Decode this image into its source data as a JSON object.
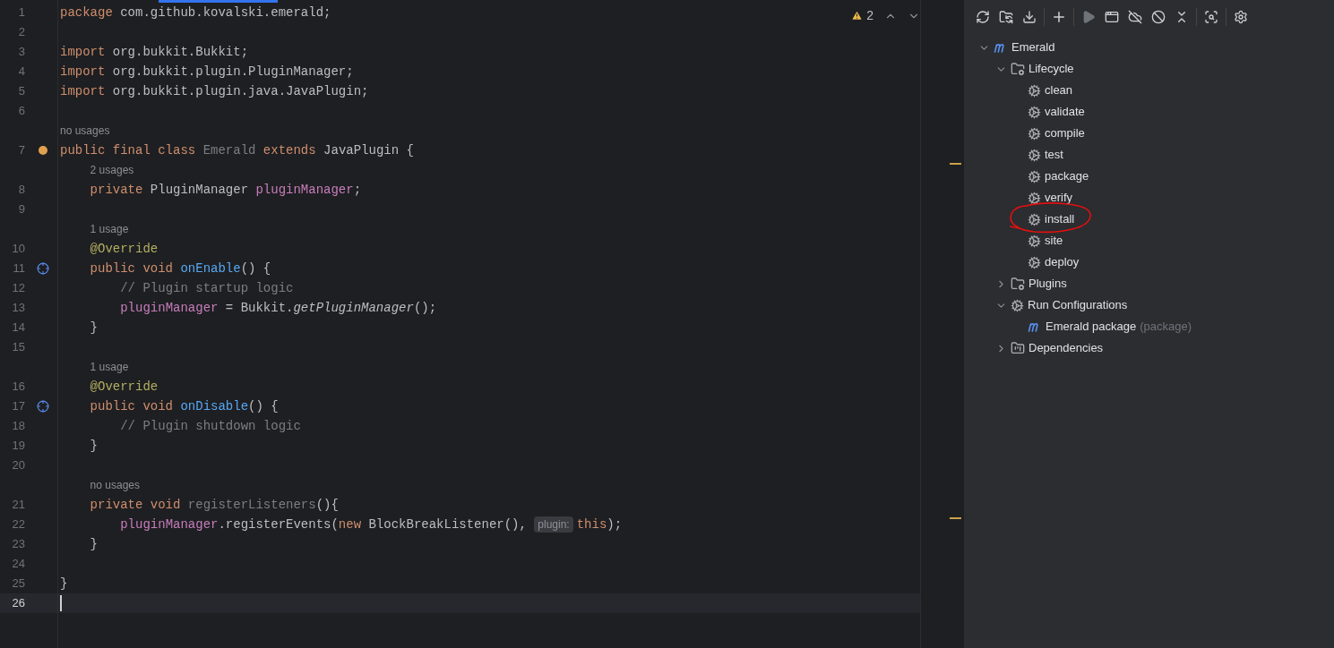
{
  "editor": {
    "warnings": {
      "count": "2"
    },
    "lines": [
      {
        "number": "1",
        "kind": "plain",
        "current": false,
        "tokens": [
          {
            "kind": "kw",
            "text": "package "
          },
          {
            "kind": "plain",
            "text": "com.github.kovalski.emerald;"
          }
        ]
      },
      {
        "number": "2",
        "kind": "plain",
        "current": false
      },
      {
        "number": "3",
        "kind": "plain",
        "current": false,
        "tokens": [
          {
            "kind": "kw",
            "text": "import "
          },
          {
            "kind": "plain",
            "text": "org.bukkit.Bukkit;"
          }
        ]
      },
      {
        "number": "4",
        "kind": "plain",
        "current": false,
        "tokens": [
          {
            "kind": "kw",
            "text": "import "
          },
          {
            "kind": "plain",
            "text": "org.bukkit.plugin.PluginManager;"
          }
        ]
      },
      {
        "number": "5",
        "kind": "plain",
        "current": false,
        "tokens": [
          {
            "kind": "kw",
            "text": "import "
          },
          {
            "kind": "plain",
            "text": "org.bukkit.plugin.java.JavaPlugin;"
          }
        ]
      },
      {
        "number": "6",
        "kind": "plain",
        "current": false
      },
      {
        "number": "7",
        "kind": "plugin",
        "current": false,
        "usages": "no usages",
        "tokens": [
          {
            "kind": "kw",
            "text": "public final class "
          },
          {
            "kind": "unused",
            "text": "Emerald "
          },
          {
            "kind": "kw",
            "text": "extends "
          },
          {
            "kind": "plain",
            "text": "JavaPlugin {"
          }
        ]
      },
      {
        "number": "8",
        "kind": "plain",
        "current": false,
        "usages": "2 usages",
        "tokens": [
          {
            "kind": "kw",
            "text": "    private "
          },
          {
            "kind": "plain",
            "text": "PluginManager "
          },
          {
            "kind": "field",
            "text": "pluginManager"
          },
          {
            "kind": "plain",
            "text": ";"
          }
        ]
      },
      {
        "number": "9",
        "kind": "plain",
        "current": false
      },
      {
        "number": "10",
        "kind": "plain",
        "current": false,
        "usages": "1 usage",
        "tokens": [
          {
            "kind": "annotation",
            "text": "    @Override"
          }
        ]
      },
      {
        "number": "11",
        "kind": "override",
        "current": false,
        "tokens": [
          {
            "kind": "kw",
            "text": "    public void "
          },
          {
            "kind": "method",
            "text": "onEnable"
          },
          {
            "kind": "plain",
            "text": "() {"
          }
        ]
      },
      {
        "number": "12",
        "kind": "plain",
        "current": false,
        "tokens": [
          {
            "kind": "comment",
            "text": "        // Plugin startup logic"
          }
        ]
      },
      {
        "number": "13",
        "kind": "plain",
        "current": false,
        "tokens": [
          {
            "kind": "field",
            "text": "        pluginManager"
          },
          {
            "kind": "plain",
            "text": " = Bukkit."
          },
          {
            "kind": "static",
            "text": "getPluginManager"
          },
          {
            "kind": "plain",
            "text": "();"
          }
        ]
      },
      {
        "number": "14",
        "kind": "plain",
        "current": false,
        "tokens": [
          {
            "kind": "plain",
            "text": "    }"
          }
        ]
      },
      {
        "number": "15",
        "kind": "plain",
        "current": false
      },
      {
        "number": "16",
        "kind": "plain",
        "current": false,
        "usages": "1 usage",
        "tokens": [
          {
            "kind": "annotation",
            "text": "    @Override"
          }
        ]
      },
      {
        "number": "17",
        "kind": "override",
        "current": false,
        "tokens": [
          {
            "kind": "kw",
            "text": "    public void "
          },
          {
            "kind": "method",
            "text": "onDisable"
          },
          {
            "kind": "plain",
            "text": "() {"
          }
        ]
      },
      {
        "number": "18",
        "kind": "plain",
        "current": false,
        "tokens": [
          {
            "kind": "comment",
            "text": "        // Plugin shutdown logic"
          }
        ]
      },
      {
        "number": "19",
        "kind": "plain",
        "current": false,
        "tokens": [
          {
            "kind": "plain",
            "text": "    }"
          }
        ]
      },
      {
        "number": "20",
        "kind": "plain",
        "current": false
      },
      {
        "number": "21",
        "kind": "plain",
        "current": false,
        "usages": "no usages",
        "tokens": [
          {
            "kind": "kw",
            "text": "    private void "
          },
          {
            "kind": "unused",
            "text": "registerListeners"
          },
          {
            "kind": "plain",
            "text": "(){"
          }
        ]
      },
      {
        "number": "22",
        "kind": "plain",
        "current": false,
        "tokens": [
          {
            "kind": "field",
            "text": "        pluginManager"
          },
          {
            "kind": "plain",
            "text": ".registerEvents("
          },
          {
            "kind": "kw",
            "text": "new "
          },
          {
            "kind": "plain",
            "text": "BlockBreakListener(), "
          },
          {
            "kind": "hint",
            "text": "plugin:"
          },
          {
            "kind": "kw",
            "text": "this"
          },
          {
            "kind": "plain",
            "text": ");"
          }
        ]
      },
      {
        "number": "23",
        "kind": "plain",
        "current": false,
        "tokens": [
          {
            "kind": "plain",
            "text": "    }"
          }
        ]
      },
      {
        "number": "24",
        "kind": "plain",
        "current": false
      },
      {
        "number": "25",
        "kind": "plain",
        "current": false,
        "tokens": [
          {
            "kind": "plain",
            "text": "}"
          }
        ]
      },
      {
        "number": "26",
        "kind": "plain",
        "current": true
      }
    ]
  },
  "maven": {
    "tree": [
      {
        "label": "Emerald",
        "kind": "project",
        "expanded": true,
        "children": [
          {
            "label": "Lifecycle",
            "kind": "folder",
            "expanded": true,
            "children": [
              {
                "label": "clean",
                "kind": "goal",
                "circled": false
              },
              {
                "label": "validate",
                "kind": "goal",
                "circled": false
              },
              {
                "label": "compile",
                "kind": "goal",
                "circled": false
              },
              {
                "label": "test",
                "kind": "goal",
                "circled": false
              },
              {
                "label": "package",
                "kind": "goal",
                "circled": false
              },
              {
                "label": "verify",
                "kind": "goal",
                "circled": false
              },
              {
                "label": "install",
                "kind": "goal",
                "circled": true
              },
              {
                "label": "site",
                "kind": "goal",
                "circled": false
              },
              {
                "label": "deploy",
                "kind": "goal",
                "circled": false
              }
            ]
          },
          {
            "label": "Plugins",
            "kind": "folder",
            "expanded": false
          },
          {
            "label": "Run Configurations",
            "kind": "goal",
            "expanded": true,
            "children": [
              {
                "label": "Emerald package",
                "suffix": "(package)",
                "kind": "project"
              }
            ]
          },
          {
            "label": "Dependencies",
            "kind": "deps",
            "expanded": false
          }
        ]
      }
    ]
  }
}
